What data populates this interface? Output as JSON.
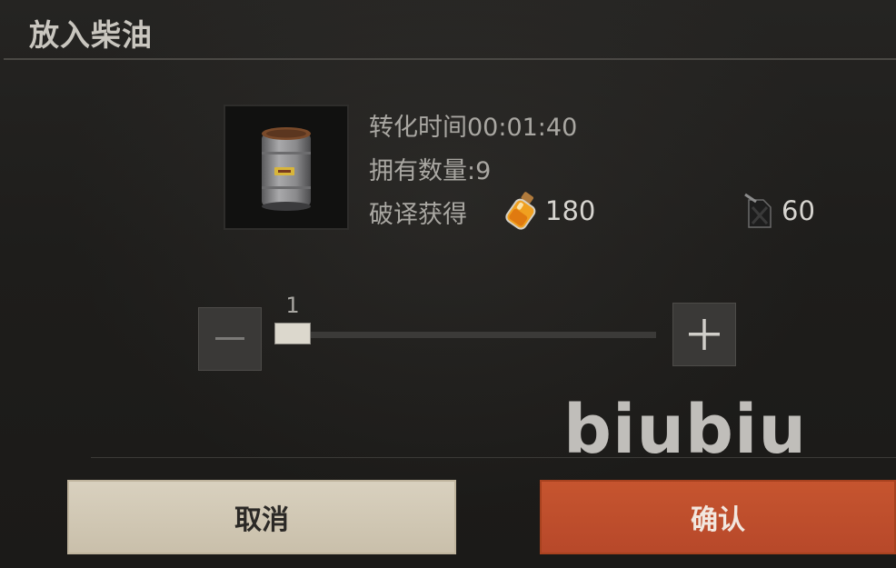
{
  "dialog": {
    "title": "放入柴油"
  },
  "item": {
    "icon": "oil-barrel-icon",
    "conversion_time": "转化时间00:01:40",
    "owned_count": "拥有数量:9",
    "reward_label": "破译获得"
  },
  "rewards": [
    {
      "icon": "potion-jar-icon",
      "amount": "180"
    },
    {
      "icon": "fuel-canister-icon",
      "amount": "60"
    }
  ],
  "quantity": {
    "value": "1",
    "min": 1,
    "max": 9,
    "decrement_icon": "minus-icon",
    "increment_icon": "plus-icon"
  },
  "watermark": "biubiu",
  "buttons": {
    "cancel": "取消",
    "confirm": "确认"
  },
  "colors": {
    "background": "#1f1e1c",
    "cancel_button": "#d5ccba",
    "confirm_button": "#c0502d",
    "reward_text": "#d7d5d0"
  }
}
